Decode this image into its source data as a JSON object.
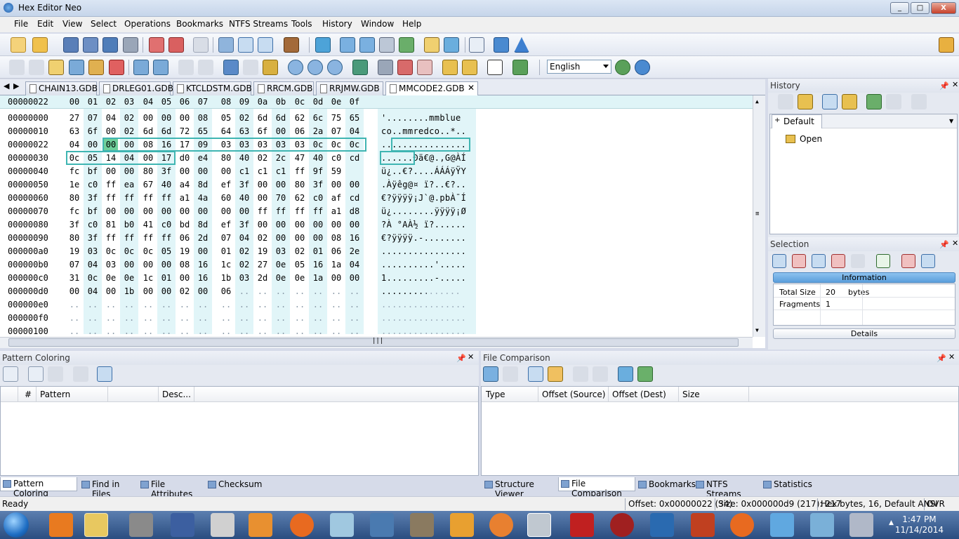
{
  "window": {
    "title": "Hex Editor Neo",
    "min": "_",
    "max": "□",
    "close": "X"
  },
  "menu": [
    "File",
    "Edit",
    "View",
    "Select",
    "Operations",
    "Bookmarks",
    "NTFS Streams",
    "Tools",
    "History",
    "Window",
    "Help"
  ],
  "language": "English",
  "tabs": [
    "CHAIN13.GDB",
    "DRLEG01.GDB",
    "KTCLDSTM.GDB",
    "RRCM.GDB",
    "RRJMW.GDB",
    "MMCODE2.GDB"
  ],
  "tab_close": "✕",
  "hex": {
    "header_offset": "00000022",
    "header_cols": [
      "00",
      "01",
      "02",
      "03",
      "04",
      "05",
      "06",
      "07",
      "08",
      "09",
      "0a",
      "0b",
      "0c",
      "0d",
      "0e",
      "0f"
    ],
    "rows": [
      {
        "off": "00000000",
        "b": [
          "27",
          "07",
          "04",
          "02",
          "00",
          "00",
          "00",
          "08",
          "05",
          "02",
          "6d",
          "6d",
          "62",
          "6c",
          "75",
          "65"
        ],
        "a": "'........mmblue"
      },
      {
        "off": "00000010",
        "b": [
          "63",
          "6f",
          "00",
          "02",
          "6d",
          "6d",
          "72",
          "65",
          "64",
          "63",
          "6f",
          "00",
          "06",
          "2a",
          "07",
          "04"
        ],
        "a": "co..mmredco..*.."
      },
      {
        "off": "00000022",
        "b": [
          "04",
          "00",
          "00",
          "00",
          "08",
          "16",
          "17",
          "09",
          "03",
          "03",
          "03",
          "03",
          "03",
          "0c",
          "0c",
          "0c"
        ],
        "a": "................"
      },
      {
        "off": "00000030",
        "b": [
          "0c",
          "05",
          "14",
          "04",
          "00",
          "17",
          "d0",
          "e4",
          "80",
          "40",
          "02",
          "2c",
          "47",
          "40",
          "c0",
          "cd"
        ],
        "a": "......Ðä€@.,G@ÀÍ"
      },
      {
        "off": "00000040",
        "b": [
          "fc",
          "bf",
          "00",
          "00",
          "80",
          "3f",
          "00",
          "00",
          "00",
          "c1",
          "c1",
          "c1",
          "ff",
          "9f",
          "59",
          ""
        ],
        "a": "ü¿..€?....ÁÁÁÿŸY"
      },
      {
        "off": "00000050",
        "b": [
          "1e",
          "c0",
          "ff",
          "ea",
          "67",
          "40",
          "a4",
          "8d",
          "ef",
          "3f",
          "00",
          "00",
          "80",
          "3f",
          "00",
          "00"
        ],
        "a": ".Àÿêg@¤ ï?..€?.."
      },
      {
        "off": "00000060",
        "b": [
          "80",
          "3f",
          "ff",
          "ff",
          "ff",
          "ff",
          "a1",
          "4a",
          "60",
          "40",
          "00",
          "70",
          "62",
          "c0",
          "af",
          "cd"
        ],
        "a": "€?ÿÿÿÿ¡J`@.pbÀ¯Í"
      },
      {
        "off": "00000070",
        "b": [
          "fc",
          "bf",
          "00",
          "00",
          "00",
          "00",
          "00",
          "00",
          "00",
          "00",
          "ff",
          "ff",
          "ff",
          "ff",
          "a1",
          "d8"
        ],
        "a": "ü¿........ÿÿÿÿ¡Ø"
      },
      {
        "off": "00000080",
        "b": [
          "3f",
          "c0",
          "81",
          "b0",
          "41",
          "c0",
          "bd",
          "8d",
          "ef",
          "3f",
          "00",
          "00",
          "00",
          "00",
          "00",
          "00"
        ],
        "a": "?À °AÀ½ ï?......"
      },
      {
        "off": "00000090",
        "b": [
          "80",
          "3f",
          "ff",
          "ff",
          "ff",
          "ff",
          "06",
          "2d",
          "07",
          "04",
          "02",
          "00",
          "00",
          "00",
          "08",
          "16"
        ],
        "a": "€?ÿÿÿÿ.-........"
      },
      {
        "off": "000000a0",
        "b": [
          "19",
          "03",
          "0c",
          "0c",
          "0c",
          "05",
          "19",
          "00",
          "01",
          "02",
          "19",
          "03",
          "02",
          "01",
          "06",
          "2e"
        ],
        "a": "................"
      },
      {
        "off": "000000b0",
        "b": [
          "07",
          "04",
          "03",
          "00",
          "00",
          "00",
          "08",
          "16",
          "1c",
          "02",
          "27",
          "0e",
          "05",
          "16",
          "1a",
          "04"
        ],
        "a": "..........'....."
      },
      {
        "off": "000000c0",
        "b": [
          "31",
          "0c",
          "0e",
          "0e",
          "1c",
          "01",
          "00",
          "16",
          "1b",
          "03",
          "2d",
          "0e",
          "0e",
          "1a",
          "00",
          "00"
        ],
        "a": "1.........-....."
      },
      {
        "off": "000000d0",
        "b": [
          "00",
          "04",
          "00",
          "1b",
          "00",
          "00",
          "02",
          "00",
          "06",
          "..",
          "..",
          "..",
          "..",
          "..",
          "..",
          ".."
        ],
        "a": "........."
      },
      {
        "off": "000000e0",
        "b": [
          "..",
          "..",
          "..",
          "..",
          "..",
          "..",
          "..",
          "..",
          "..",
          "..",
          "..",
          "..",
          "..",
          "..",
          "..",
          ".."
        ],
        "a": ""
      },
      {
        "off": "000000f0",
        "b": [
          "..",
          "..",
          "..",
          "..",
          "..",
          "..",
          "..",
          "..",
          "..",
          "..",
          "..",
          "..",
          "..",
          "..",
          "..",
          ".."
        ],
        "a": ""
      },
      {
        "off": "00000100",
        "b": [
          "..",
          "..",
          "..",
          "..",
          "..",
          "..",
          "..",
          "..",
          "..",
          "..",
          "..",
          "..",
          "..",
          "..",
          "..",
          ".."
        ],
        "a": ""
      }
    ]
  },
  "history": {
    "title": "History",
    "root": "Default",
    "item": "Open"
  },
  "selection": {
    "title": "Selection",
    "info_label": "Information",
    "total_label": "Total Size",
    "total_val": "20",
    "total_unit": "bytes",
    "frag_label": "Fragments",
    "frag_val": "1",
    "details": "Details"
  },
  "pattern": {
    "title": "Pattern Coloring",
    "cols": [
      "#",
      "Pattern",
      "Desc..."
    ]
  },
  "compare": {
    "title": "File Comparison",
    "cols": [
      "Type",
      "Offset (Source)",
      "Offset (Dest)",
      "Size"
    ]
  },
  "bottom_tabs_left": [
    "Pattern Coloring",
    "Find in Files",
    "File Attributes",
    "Checksum"
  ],
  "bottom_tabs_right": [
    "Structure Viewer",
    "File Comparison",
    "Bookmarks",
    "NTFS Streams",
    "Statistics"
  ],
  "status": {
    "ready": "Ready",
    "offset": "Offset: 0x00000022 (34)",
    "size": "Size: 0x000000d9 (217): 217",
    "mode": "Hex bytes, 16, Default ANSI",
    "ovr": "OVR"
  },
  "clock": {
    "time": "1:47 PM",
    "date": "11/14/2014"
  },
  "colors": {
    "accent": "#3fb5b2",
    "selected_byte": "#6fcf9a",
    "col_tint": "#e1f5f8"
  }
}
